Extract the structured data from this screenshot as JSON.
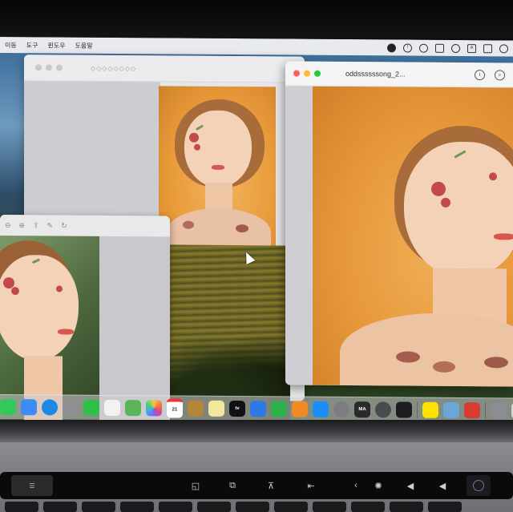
{
  "menubar": {
    "items": [
      "이동",
      "도구",
      "윈도우",
      "도움말"
    ]
  },
  "finder_window": {
    "title": "◇◇◇◇◇◇◇◇"
  },
  "preview_window": {
    "filename": "oddssssssong_2..."
  },
  "dock": {
    "calendar_day": "21",
    "tv_label": "tv",
    "ma_label": "MA",
    "apps": [
      {
        "name": "messages",
        "color": "#34c759"
      },
      {
        "name": "mail",
        "color": "#3d8bf5"
      },
      {
        "name": "safari",
        "color": "#1e88e5"
      },
      {
        "name": "launchpad",
        "color": "#8e8e93"
      },
      {
        "name": "facetime",
        "color": "#30c04a"
      },
      {
        "name": "reminders",
        "color": "#f2f2f4"
      },
      {
        "name": "maps",
        "color": "#5ab55a"
      },
      {
        "name": "photos",
        "color": "#f5f5f5"
      },
      {
        "name": "calendar",
        "color": "#ffffff"
      },
      {
        "name": "finder-brown",
        "color": "#b3863a"
      },
      {
        "name": "notes",
        "color": "#f3e7a0"
      },
      {
        "name": "apple-tv",
        "color": "#111111"
      },
      {
        "name": "keynote",
        "color": "#2c7be5"
      },
      {
        "name": "numbers",
        "color": "#2db24b"
      },
      {
        "name": "pages",
        "color": "#f08a24"
      },
      {
        "name": "app-store",
        "color": "#1c8ef9"
      },
      {
        "name": "system-preferences",
        "color": "#7c7c82"
      },
      {
        "name": "ma-app",
        "color": "#2a2a2a"
      },
      {
        "name": "steam",
        "color": "#4a4a4f"
      },
      {
        "name": "unity",
        "color": "#1d1d1f"
      },
      {
        "name": "kakaotalk",
        "color": "#ffe000"
      },
      {
        "name": "preview",
        "color": "#6aa7d8"
      },
      {
        "name": "photo-booth",
        "color": "#d83a34"
      },
      {
        "name": "downloads",
        "color": "#8c8c92"
      },
      {
        "name": "trash",
        "color": "#d5d5d9"
      }
    ]
  },
  "touchbar": {
    "icons": [
      "menu-icon",
      "brightness-down-icon",
      "brightness-up-icon",
      "mission-control-icon",
      "launchpad-icon",
      "rewind-icon",
      "play-pause-icon",
      "mute-icon",
      "volume-icon",
      "siri-icon"
    ]
  }
}
